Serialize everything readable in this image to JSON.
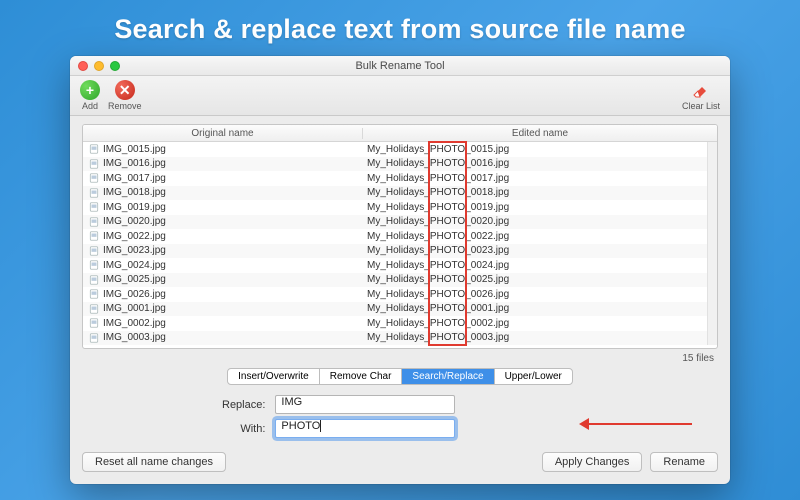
{
  "headline": "Search & replace text from source file name",
  "window": {
    "title": "Bulk Rename Tool",
    "toolbar": {
      "add": "Add",
      "remove": "Remove",
      "clear": "Clear List"
    },
    "columns": {
      "original": "Original name",
      "edited": "Edited name"
    },
    "rows": [
      {
        "orig": "IMG_0015.jpg",
        "p": "My_Holidays_",
        "h": "PHOTO",
        "s": "_0015.jpg"
      },
      {
        "orig": "IMG_0016.jpg",
        "p": "My_Holidays_",
        "h": "PHOTO",
        "s": "_0016.jpg"
      },
      {
        "orig": "IMG_0017.jpg",
        "p": "My_Holidays_",
        "h": "PHOTO",
        "s": "_0017.jpg"
      },
      {
        "orig": "IMG_0018.jpg",
        "p": "My_Holidays_",
        "h": "PHOTO",
        "s": "_0018.jpg"
      },
      {
        "orig": "IMG_0019.jpg",
        "p": "My_Holidays_",
        "h": "PHOTO",
        "s": "_0019.jpg"
      },
      {
        "orig": "IMG_0020.jpg",
        "p": "My_Holidays_",
        "h": "PHOTO",
        "s": "_0020.jpg"
      },
      {
        "orig": "IMG_0022.jpg",
        "p": "My_Holidays_",
        "h": "PHOTO",
        "s": "_0022.jpg"
      },
      {
        "orig": "IMG_0023.jpg",
        "p": "My_Holidays_",
        "h": "PHOTO",
        "s": "_0023.jpg"
      },
      {
        "orig": "IMG_0024.jpg",
        "p": "My_Holidays_",
        "h": "PHOTO",
        "s": "_0024.jpg"
      },
      {
        "orig": "IMG_0025.jpg",
        "p": "My_Holidays_",
        "h": "PHOTO",
        "s": "_0025.jpg"
      },
      {
        "orig": "IMG_0026.jpg",
        "p": "My_Holidays_",
        "h": "PHOTO",
        "s": "_0026.jpg"
      },
      {
        "orig": "IMG_0001.jpg",
        "p": "My_Holidays_",
        "h": "PHOTO",
        "s": "_0001.jpg"
      },
      {
        "orig": "IMG_0002.jpg",
        "p": "My_Holidays_",
        "h": "PHOTO",
        "s": "_0002.jpg"
      },
      {
        "orig": "IMG_0003.jpg",
        "p": "My_Holidays_",
        "h": "PHOTO",
        "s": "_0003.jpg"
      }
    ],
    "file_count": "15 files",
    "tabs": {
      "insert": "Insert/Overwrite",
      "remove_char": "Remove Char",
      "search_replace": "Search/Replace",
      "upper_lower": "Upper/Lower"
    },
    "form": {
      "replace_label": "Replace:",
      "replace_value": "IMG",
      "with_label": "With:",
      "with_value": "PHOTO"
    },
    "footer": {
      "reset": "Reset all name changes",
      "apply": "Apply Changes",
      "rename": "Rename"
    }
  }
}
